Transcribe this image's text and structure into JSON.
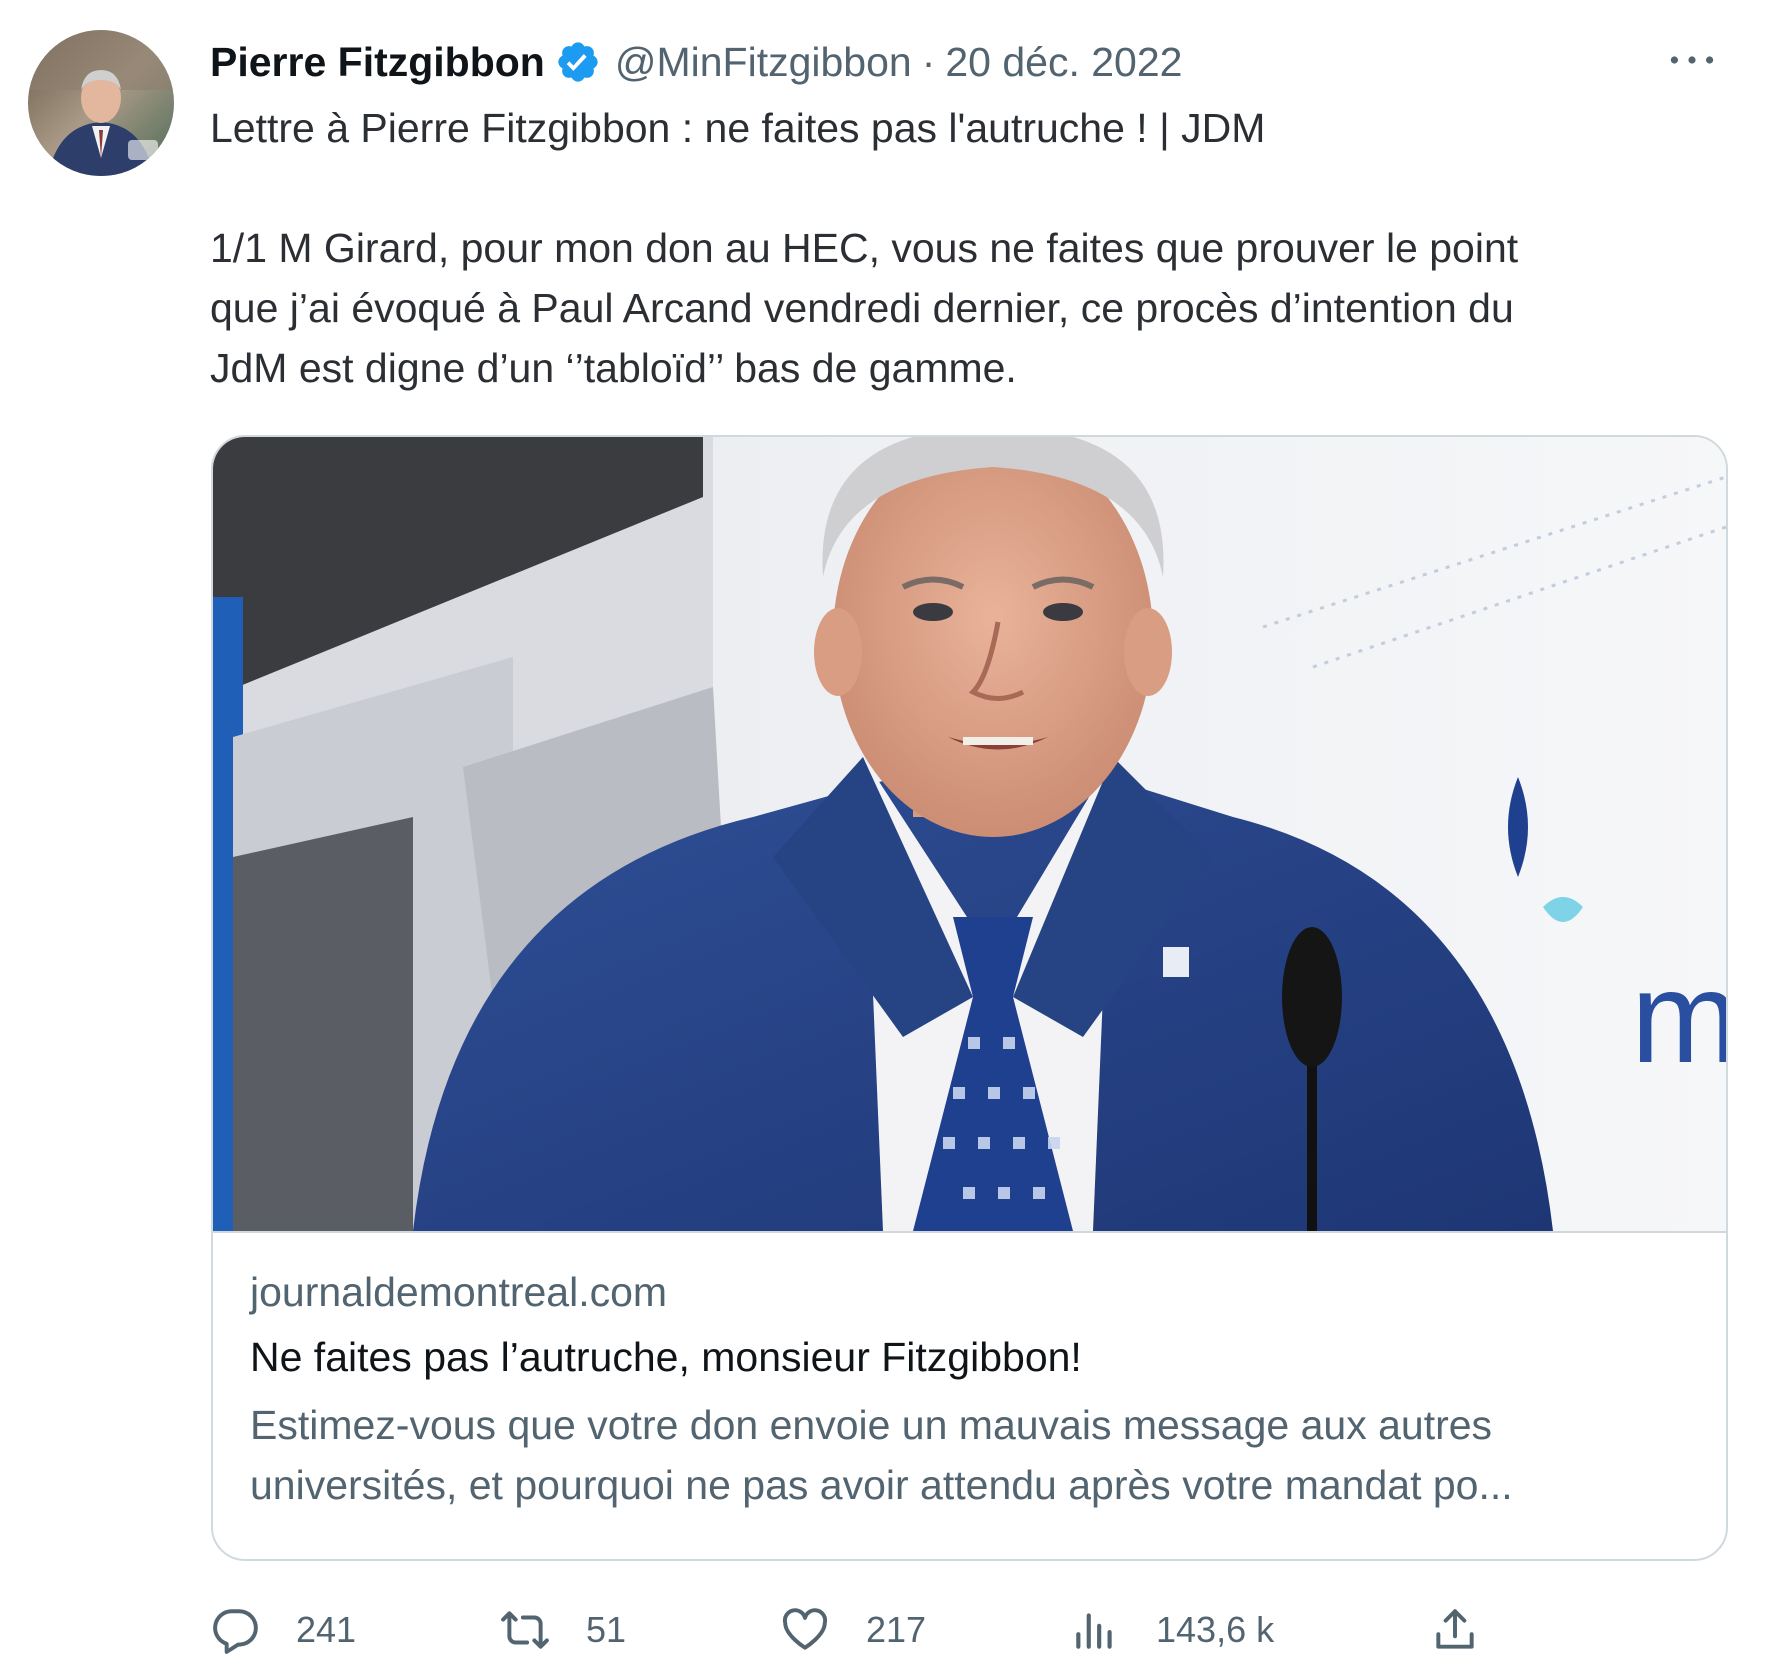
{
  "author": {
    "display_name": "Pierre Fitzgibbon",
    "handle": "@MinFitzgibbon",
    "separator": "·",
    "date": "20 déc. 2022",
    "verified": true,
    "verified_color": "#1d9bf0"
  },
  "more_icon": "more-horizontal-icon",
  "tweet": {
    "line1": "Lettre à Pierre Fitzgibbon : ne faites pas l'autruche ! | JDM",
    "body_lines": [
      "1/1 M Girard, pour mon don au HEC, vous ne faites que prouver le point",
      "que j’ai évoqué à Paul Arcand vendredi dernier, ce procès d’intention du",
      "JdM est digne d’un ‘’tabloïd’’ bas de gamme."
    ]
  },
  "card": {
    "domain": "journaldemontreal.com",
    "title": "Ne faites pas l’autruche, monsieur Fitzgibbon!",
    "description_lines": [
      "Estimez-vous que votre don envoie un mauvais message aux autres",
      "universités, et pourquoi ne pas avoir attendu après votre mandat po..."
    ],
    "image_partial_logo_text": "me"
  },
  "actions": {
    "reply": {
      "icon": "reply-icon",
      "count": "241"
    },
    "retweet": {
      "icon": "retweet-icon",
      "count": "51"
    },
    "like": {
      "icon": "heart-icon",
      "count": "217"
    },
    "views": {
      "icon": "analytics-icon",
      "count": "143,6 k"
    },
    "share": {
      "icon": "share-icon"
    }
  },
  "colors": {
    "text_primary": "#0f1419",
    "text_secondary": "#536471",
    "border": "#cfd9de",
    "accent": "#1d9bf0"
  }
}
